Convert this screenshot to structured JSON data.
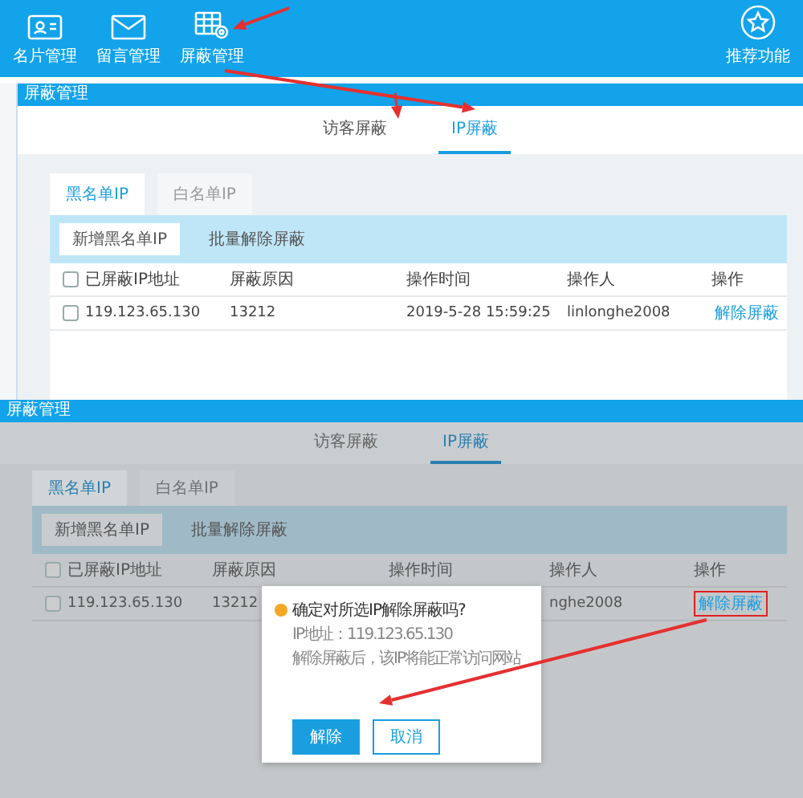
{
  "toolbar": {
    "items": [
      {
        "label": "名片管理",
        "kind": "card"
      },
      {
        "label": "留言管理",
        "kind": "mail"
      },
      {
        "label": "屏蔽管理",
        "kind": "grid"
      }
    ],
    "right": {
      "label": "推荐功能",
      "kind": "star"
    }
  },
  "panels": [
    {
      "title": "屏蔽管理",
      "dimmed": false,
      "tabs": [
        {
          "label": "访客屏蔽",
          "selected": false
        },
        {
          "label": "IP屏蔽",
          "selected": true
        }
      ],
      "subtabs": [
        {
          "label": "黑名单IP",
          "selected": true
        },
        {
          "label": "白名单IP",
          "selected": false
        }
      ],
      "actions": [
        "新增黑名单IP",
        "批量解除屏蔽"
      ],
      "all_checked": false,
      "columns": [
        "已屏蔽IP地址",
        "屏蔽原因",
        "操作时间",
        "操作人",
        "操作"
      ],
      "rows": [
        {
          "checked": false,
          "cells": [
            "119.123.65.130",
            "13212",
            "2019-5-28 15:59:25",
            "linlonghe2008"
          ],
          "action": {
            "label": "解除屏蔽",
            "highlighted": false
          }
        }
      ]
    },
    {
      "title": "屏蔽管理",
      "dimmed": true,
      "tabs": [
        {
          "label": "访客屏蔽",
          "selected": false
        },
        {
          "label": "IP屏蔽",
          "selected": true
        }
      ],
      "subtabs": [
        {
          "label": "黑名单IP",
          "selected": true
        },
        {
          "label": "白名单IP",
          "selected": false
        }
      ],
      "actions": [
        "新增黑名单IP",
        "批量解除屏蔽"
      ],
      "all_checked": false,
      "columns": [
        "已屏蔽IP地址",
        "屏蔽原因",
        "操作时间",
        "操作人",
        "操作"
      ],
      "rows": [
        {
          "checked": false,
          "cells": [
            "119.123.65.130",
            "13212",
            null,
            "nghe2008"
          ],
          "action": {
            "label": "解除屏蔽",
            "highlighted": true
          }
        }
      ],
      "dialog": {
        "title": "确定对所选IP解除屏蔽吗?",
        "lines": [
          "IP地址：119.123.65.130",
          "解除屏蔽后，该IP将能正常访问网站"
        ],
        "buttons": [
          {
            "label": "解除",
            "kind": "primary"
          },
          {
            "label": "取消",
            "kind": "secondary"
          }
        ]
      }
    }
  ]
}
